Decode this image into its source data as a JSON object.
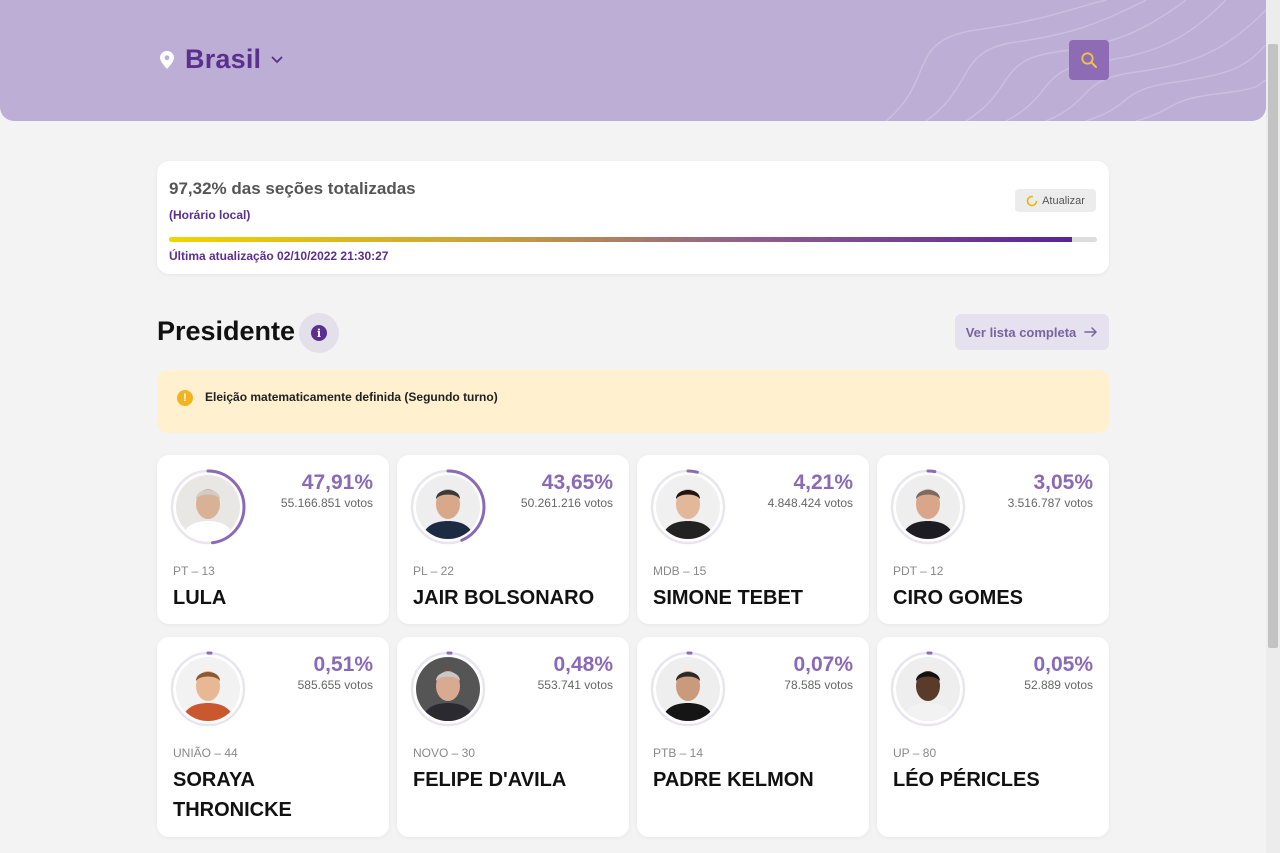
{
  "header": {
    "location": "Brasil"
  },
  "status": {
    "title": "97,32% das seções totalizadas",
    "subtitle": "(Horário local)",
    "refresh_label": "Atualizar",
    "progress": 0.9732,
    "updated": "Última atualização 02/10/2022 21:30:27"
  },
  "section": {
    "title": "Presidente",
    "full_list_label": "Ver lista completa"
  },
  "alert": {
    "text": "Eleição matematicamente definida (Segundo turno)"
  },
  "colors": {
    "accent": "#8a6ab5",
    "brand": "#5b2f8e",
    "header_bg": "#bcaed4",
    "alert_bg": "#fff1d0"
  },
  "candidates": [
    {
      "party": "PT – 13",
      "name": "LULA",
      "pct": "47,91%",
      "votes": "55.166.851 votos",
      "share": 0.4791,
      "bg": "#e9e7e4",
      "skin": "#d9b296",
      "hair": "#d0ccc6",
      "suit": "#ffffff"
    },
    {
      "party": "PL – 22",
      "name": "JAIR BOLSONARO",
      "pct": "43,65%",
      "votes": "50.261.216 votos",
      "share": 0.4365,
      "bg": "#eeeeee",
      "skin": "#d7a98a",
      "hair": "#3a3a3a",
      "suit": "#1d2a44"
    },
    {
      "party": "MDB – 15",
      "name": "SIMONE TEBET",
      "pct": "4,21%",
      "votes": "4.848.424 votos",
      "share": 0.0421,
      "bg": "#f0f0f0",
      "skin": "#e2b79a",
      "hair": "#1f1612",
      "suit": "#222222"
    },
    {
      "party": "PDT – 12",
      "name": "CIRO GOMES",
      "pct": "3,05%",
      "votes": "3.516.787 votos",
      "share": 0.0305,
      "bg": "#eeeeee",
      "skin": "#d9a68a",
      "hair": "#7a6a60",
      "suit": "#1c1c22"
    },
    {
      "party": "UNIÃO – 44",
      "name": "SORAYA THRONICKE",
      "pct": "0,51%",
      "votes": "585.655 votos",
      "share": 0.0051,
      "bg": "#f2f2f2",
      "skin": "#e8b794",
      "hair": "#8a5a32",
      "suit": "#c9582e"
    },
    {
      "party": "NOVO – 30",
      "name": "FELIPE D'AVILA",
      "pct": "0,48%",
      "votes": "553.741 votos",
      "share": 0.0048,
      "bg": "#555555",
      "skin": "#d8ab90",
      "hair": "#c8c8c8",
      "suit": "#2a2a30"
    },
    {
      "party": "PTB – 14",
      "name": "PADRE KELMON",
      "pct": "0,07%",
      "votes": "78.585 votos",
      "share": 0.0007,
      "bg": "#eeeeee",
      "skin": "#c99a7c",
      "hair": "#2a2a2a",
      "suit": "#151515"
    },
    {
      "party": "UP – 80",
      "name": "LÉO PÉRICLES",
      "pct": "0,05%",
      "votes": "52.889 votos",
      "share": 0.0005,
      "bg": "#eeeeee",
      "skin": "#5a3a28",
      "hair": "#111111",
      "suit": "#f2f2f2"
    }
  ]
}
